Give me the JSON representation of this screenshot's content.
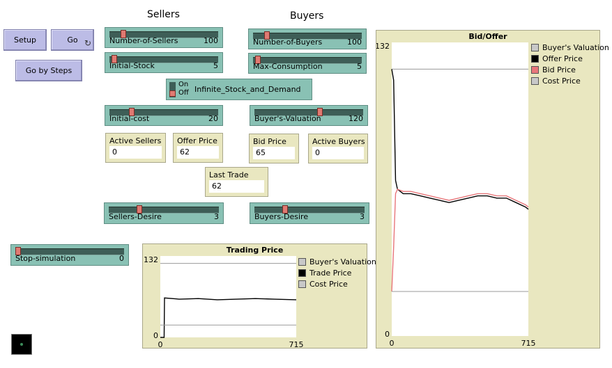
{
  "headers": {
    "sellers": "Sellers",
    "buyers": "Buyers"
  },
  "buttons": {
    "setup": "Setup",
    "go": "Go",
    "go_forever_icon": "↻",
    "go_by_steps": "Go by Steps"
  },
  "sliders": {
    "number_of_sellers": {
      "label": "Number-of-Sellers",
      "value": "100",
      "fraction": 0.1
    },
    "initial_stock": {
      "label": "Initial-Stock",
      "value": "5",
      "fraction": 0.02
    },
    "number_of_buyers": {
      "label": "Number-of-Buyers",
      "value": "100",
      "fraction": 0.1
    },
    "max_consumption": {
      "label": "Max-Consumption",
      "value": "5",
      "fraction": 0.02
    },
    "initial_cost": {
      "label": "Initial-cost",
      "value": "20",
      "fraction": 0.18
    },
    "buyers_valuation": {
      "label": "Buyer's-Valuation",
      "value": "120",
      "fraction": 0.58
    },
    "sellers_desire": {
      "label": "Sellers-Desire",
      "value": "3",
      "fraction": 0.25
    },
    "buyers_desire": {
      "label": "Buyers-Desire",
      "value": "3",
      "fraction": 0.25
    },
    "stop_simulation": {
      "label": "Stop-simulation",
      "value": "0",
      "fraction": 0.0
    }
  },
  "switch": {
    "on_label": "On",
    "off_label": "Off",
    "label": "Infinite_Stock_and_Demand",
    "state": "off"
  },
  "monitors": {
    "active_sellers": {
      "label": "Active Sellers",
      "value": "0"
    },
    "offer_price": {
      "label": "Offer Price",
      "value": "62"
    },
    "bid_price": {
      "label": "Bid Price",
      "value": "65"
    },
    "active_buyers": {
      "label": "Active Buyers",
      "value": "0"
    },
    "last_trade_price": {
      "label": "Last Trade Price",
      "value": "62"
    }
  },
  "colors": {
    "black": "#000000",
    "grey": "#9a9a9a",
    "red": "#e8767a"
  },
  "chart_data": [
    {
      "type": "line",
      "title": "Trading Price",
      "xlim": [
        0,
        715
      ],
      "ylim": [
        0,
        132
      ],
      "x_tick_labels": [
        "0",
        "715"
      ],
      "y_tick_labels": [
        "0",
        "132"
      ],
      "legend_position": "right",
      "series": [
        {
          "name": "Buyer's Valuation",
          "color": "#9a9a9a",
          "x": [
            0,
            715
          ],
          "values": [
            120,
            120
          ]
        },
        {
          "name": "Trade Price",
          "color": "#000000",
          "x": [
            0,
            20,
            22,
            100,
            200,
            300,
            400,
            500,
            600,
            715
          ],
          "values": [
            0,
            0,
            64,
            62,
            63,
            61,
            62,
            63,
            62,
            61
          ]
        },
        {
          "name": "Cost Price",
          "color": "#9a9a9a",
          "x": [
            0,
            715
          ],
          "values": [
            20,
            20
          ]
        }
      ]
    },
    {
      "type": "line",
      "title": "Bid/Offer",
      "xlim": [
        0,
        715
      ],
      "ylim": [
        0,
        132
      ],
      "x_tick_labels": [
        "0",
        "715"
      ],
      "y_tick_labels": [
        "0",
        "132"
      ],
      "legend_position": "right",
      "series": [
        {
          "name": "Buyer's Valuation",
          "color": "#9a9a9a",
          "x": [
            0,
            715
          ],
          "values": [
            120,
            120
          ]
        },
        {
          "name": "Offer Price",
          "color": "#000000",
          "x": [
            0,
            10,
            20,
            30,
            60,
            100,
            150,
            200,
            250,
            300,
            350,
            400,
            450,
            500,
            550,
            600,
            650,
            700,
            715
          ],
          "values": [
            120,
            115,
            70,
            66,
            64,
            64,
            63,
            62,
            61,
            60,
            61,
            62,
            63,
            63,
            62,
            62,
            60,
            58,
            57
          ]
        },
        {
          "name": "Bid Price",
          "color": "#e8767a",
          "x": [
            0,
            10,
            20,
            30,
            60,
            100,
            150,
            200,
            250,
            300,
            350,
            400,
            450,
            500,
            550,
            600,
            650,
            700,
            715
          ],
          "values": [
            20,
            40,
            64,
            66,
            65,
            65,
            64,
            63,
            62,
            61,
            62,
            63,
            64,
            64,
            63,
            63,
            61,
            59,
            58
          ]
        },
        {
          "name": "Cost Price",
          "color": "#9a9a9a",
          "x": [
            0,
            715
          ],
          "values": [
            20,
            20
          ]
        }
      ]
    }
  ]
}
